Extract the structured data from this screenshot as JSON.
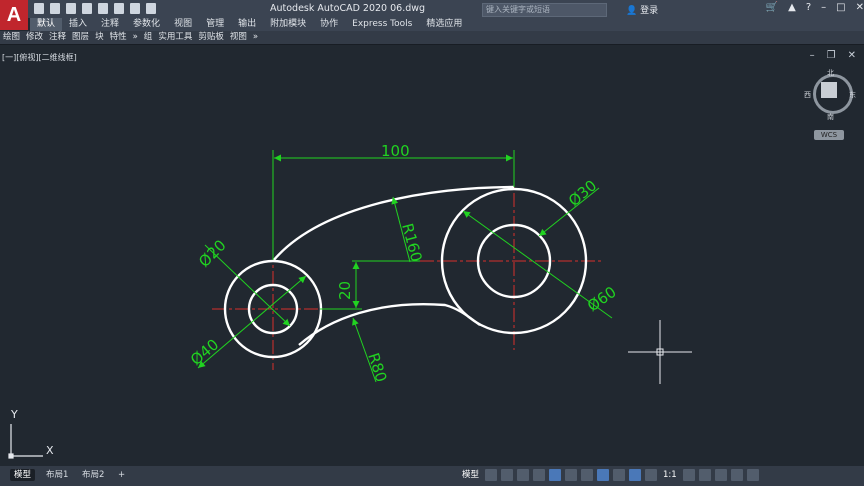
{
  "app": {
    "logo_letter": "A",
    "title": "Autodesk AutoCAD 2020    06.dwg",
    "search_placeholder": "键入关键字或短语",
    "login": "登录"
  },
  "ribbon_tabs": [
    "默认",
    "插入",
    "注释",
    "参数化",
    "视图",
    "管理",
    "输出",
    "附加模块",
    "协作",
    "Express Tools",
    "精选应用"
  ],
  "panels": [
    "绘图",
    "修改",
    "注释",
    "图层",
    "块",
    "特性",
    "»",
    "组",
    "实用工具",
    "剪贴板",
    "视图",
    "»"
  ],
  "viewport_label": "[一][俯视][二维线框]",
  "viewcube": {
    "north": "北",
    "south": "南",
    "east": "东",
    "west": "西",
    "wcs": "WCS"
  },
  "ucs": {
    "x": "X",
    "y": "Y"
  },
  "dimensions": {
    "length": "100",
    "dia_small_inner": "Ø20",
    "dia_small_outer": "Ø40",
    "dia_large_inner": "Ø30",
    "dia_large_outer": "Ø60",
    "r_top": "R160",
    "r_bottom": "R80",
    "offset": "20"
  },
  "layout_tabs": [
    "模型",
    "布局1",
    "布局2",
    "+"
  ],
  "status": {
    "model": "模型",
    "scale": "1:1"
  },
  "colors": {
    "dimension": "#21d321",
    "center": "#d8312b",
    "geometry": "#ffffff",
    "background": "#212830"
  }
}
